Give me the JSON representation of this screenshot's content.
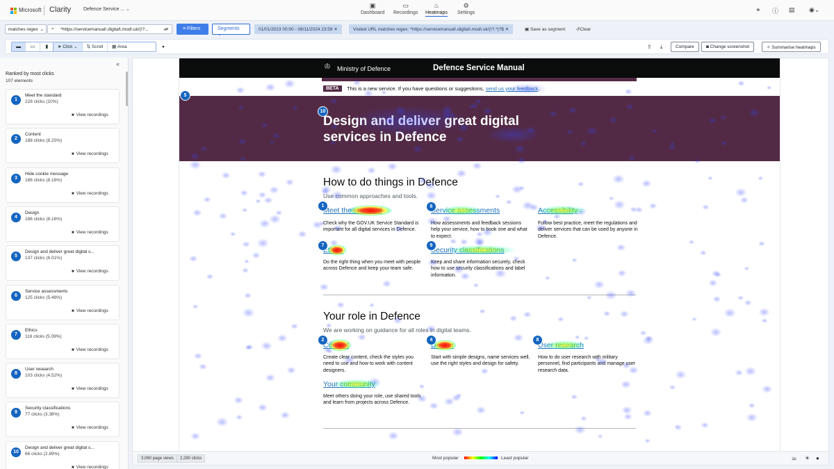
{
  "app": {
    "company": "Microsoft",
    "product": "Clarity",
    "project": "Defence Service ...",
    "nav": [
      {
        "label": "Dashboard",
        "icon": "dashboard-icon"
      },
      {
        "label": "Recordings",
        "icon": "video-icon"
      },
      {
        "label": "Heatmaps",
        "icon": "flame-icon",
        "active": true
      },
      {
        "label": "Settings",
        "icon": "gear-icon"
      }
    ]
  },
  "filters": {
    "match_type": "matches regex",
    "url_value": "^https://servicemanual\\.digital\\.mod\\.uk/(\\?...",
    "filters_label": "Filters",
    "segments_label": "Segments",
    "date_range": "01/01/2023 00:00 - 08/11/2024 23:59",
    "url_chip": "Visited URL matches regex: ^https://servicemanual\\.digital\\.mod\\.uk/(\\?.*)?$",
    "save_segment_label": "Save as segment",
    "clear_label": "Clear"
  },
  "toolbar": {
    "modes": [
      "Click",
      "Scroll",
      "Area"
    ],
    "compare_label": "Compare",
    "change_screenshot_label": "Change screenshot",
    "summarise_label": "Summarise heatmaps"
  },
  "sidebar": {
    "title": "Ranked by most clicks",
    "count": "107 elements",
    "view_recordings_label": "View recordings",
    "items": [
      {
        "rank": "1",
        "name": "Meet the standard",
        "clicks": "228 clicks (10%)"
      },
      {
        "rank": "2",
        "name": "Content",
        "clicks": "188 clicks (8.25%)"
      },
      {
        "rank": "3",
        "name": "Hide cookie message",
        "clicks": "186 clicks (8.16%)"
      },
      {
        "rank": "4",
        "name": "Design",
        "clicks": "186 clicks (8.16%)"
      },
      {
        "rank": "5",
        "name": "Design and deliver great digital s...",
        "clicks": "137 clicks (6.01%)"
      },
      {
        "rank": "6",
        "name": "Service assessments",
        "clicks": "125 clicks (5.48%)"
      },
      {
        "rank": "7",
        "name": "Ethics",
        "clicks": "116 clicks (5.09%)"
      },
      {
        "rank": "8",
        "name": "User research",
        "clicks": "103 clicks (4.52%)"
      },
      {
        "rank": "9",
        "name": "Security classifications",
        "clicks": "77 clicks (3.38%)"
      },
      {
        "rank": "10",
        "name": "Design and deliver great digital s...",
        "clicks": "66 clicks (2.89%)"
      }
    ]
  },
  "footer": {
    "page_views": "3,060 page views",
    "clicks": "2,280 clicks",
    "most_popular": "Most popular",
    "least_popular": "Least popular"
  },
  "site": {
    "org": "Ministry of Defence",
    "manual": "Defence Service Manual",
    "beta_tag": "BETA",
    "beta_text": "This is a new service. If you have questions or suggestions,",
    "beta_link": "send us your feedback",
    "hero_title": "Design and deliver great digital services in Defence",
    "section1_title": "How to do things in Defence",
    "section1_sub": "Use common approaches and tools.",
    "section1_cards": [
      {
        "title": "Meet the standard",
        "desc": "Check why the GOV.UK Service Standard is important for all digital services in Defence."
      },
      {
        "title": "Service assessments",
        "desc": "How assessments and feedback sessions help your service, how to book one and what to expect."
      },
      {
        "title": "Accessibility",
        "desc": "Follow best practice, meet the regulations and deliver services that can be used by anyone in Defence."
      },
      {
        "title": "Ethics",
        "desc": "Do the right thing when you meet with people across Defence and keep your team safe."
      },
      {
        "title": "Security classifications",
        "desc": "Keep and share information securely, check how to use security classifications and label information."
      }
    ],
    "section2_title": "Your role in Defence",
    "section2_sub": "We are working on guidance for all roles in digital teams.",
    "section2_cards": [
      {
        "title": "Content",
        "desc": "Create clear content, check the styles you need to use and how to work with content designers."
      },
      {
        "title": "Design",
        "desc": "Start with simple designs, name services well, use the right styles and design for safety."
      },
      {
        "title": "User research",
        "desc": "How to do user research with military personnel, find participants and manage user research data."
      },
      {
        "title": "Your community",
        "desc": "Meet others doing your role, use shared tools and learn from projects across Defence."
      }
    ]
  },
  "colors": {
    "accent": "#1565c0",
    "mod_purple": "#532a45",
    "link": "#1d70b8"
  }
}
